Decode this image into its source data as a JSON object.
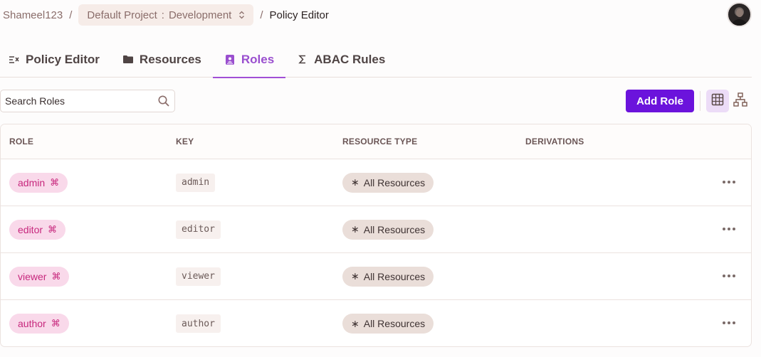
{
  "breadcrumb": {
    "org": "Shameel123",
    "project_label": "Default Project",
    "project_separator": ":",
    "environment": "Development",
    "current": "Policy Editor"
  },
  "tabs": [
    {
      "label": "Policy Editor",
      "icon": "policy-list-icon",
      "active": false
    },
    {
      "label": "Resources",
      "icon": "folder-icon",
      "active": false
    },
    {
      "label": "Roles",
      "icon": "contact-card-icon",
      "active": true
    },
    {
      "label": "ABAC Rules",
      "icon": "sigma-icon",
      "active": false
    }
  ],
  "toolbar": {
    "search_placeholder": "Search Roles",
    "add_role_label": "Add Role"
  },
  "table": {
    "headers": [
      "ROLE",
      "KEY",
      "RESOURCE TYPE",
      "DERIVATIONS"
    ],
    "rows": [
      {
        "role": "admin",
        "key": "admin",
        "resource": "All Resources",
        "derivations": ""
      },
      {
        "role": "editor",
        "key": "editor",
        "resource": "All Resources",
        "derivations": ""
      },
      {
        "role": "viewer",
        "key": "viewer",
        "resource": "All Resources",
        "derivations": ""
      },
      {
        "role": "author",
        "key": "author",
        "resource": "All Resources",
        "derivations": ""
      }
    ]
  },
  "colors": {
    "accent": "#6b13dc",
    "active_tab": "#9a4fcf",
    "role_pill_bg": "#f9d9ea",
    "role_pill_text": "#c7287d",
    "resource_pill_bg": "#eaded9"
  }
}
